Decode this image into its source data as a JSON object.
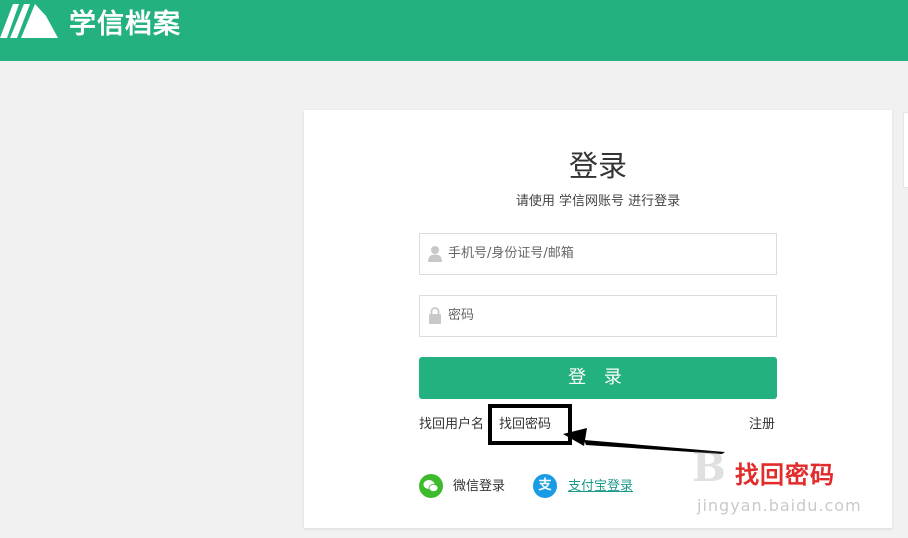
{
  "header": {
    "brand": "学信档案",
    "color": "#23b27f"
  },
  "login": {
    "title": "登录",
    "subtitle": "请使用 学信网账号 进行登录",
    "username_placeholder": "手机号/身份证号/邮箱",
    "password_placeholder": "密码",
    "button_label": "登 录",
    "forgot_username": "找回用户名",
    "forgot_password": "找回密码",
    "register": "注册",
    "wechat_login": "微信登录",
    "alipay_login": "支付宝登录",
    "icons": {
      "user": "user-icon",
      "lock": "lock-icon",
      "wechat": "wechat-icon",
      "alipay": "alipay-icon"
    }
  },
  "annotation": {
    "text": "找回密码",
    "color": "#e22b2b"
  },
  "watermark": {
    "glyph": "B",
    "text": "jingyan.baidu.com"
  }
}
